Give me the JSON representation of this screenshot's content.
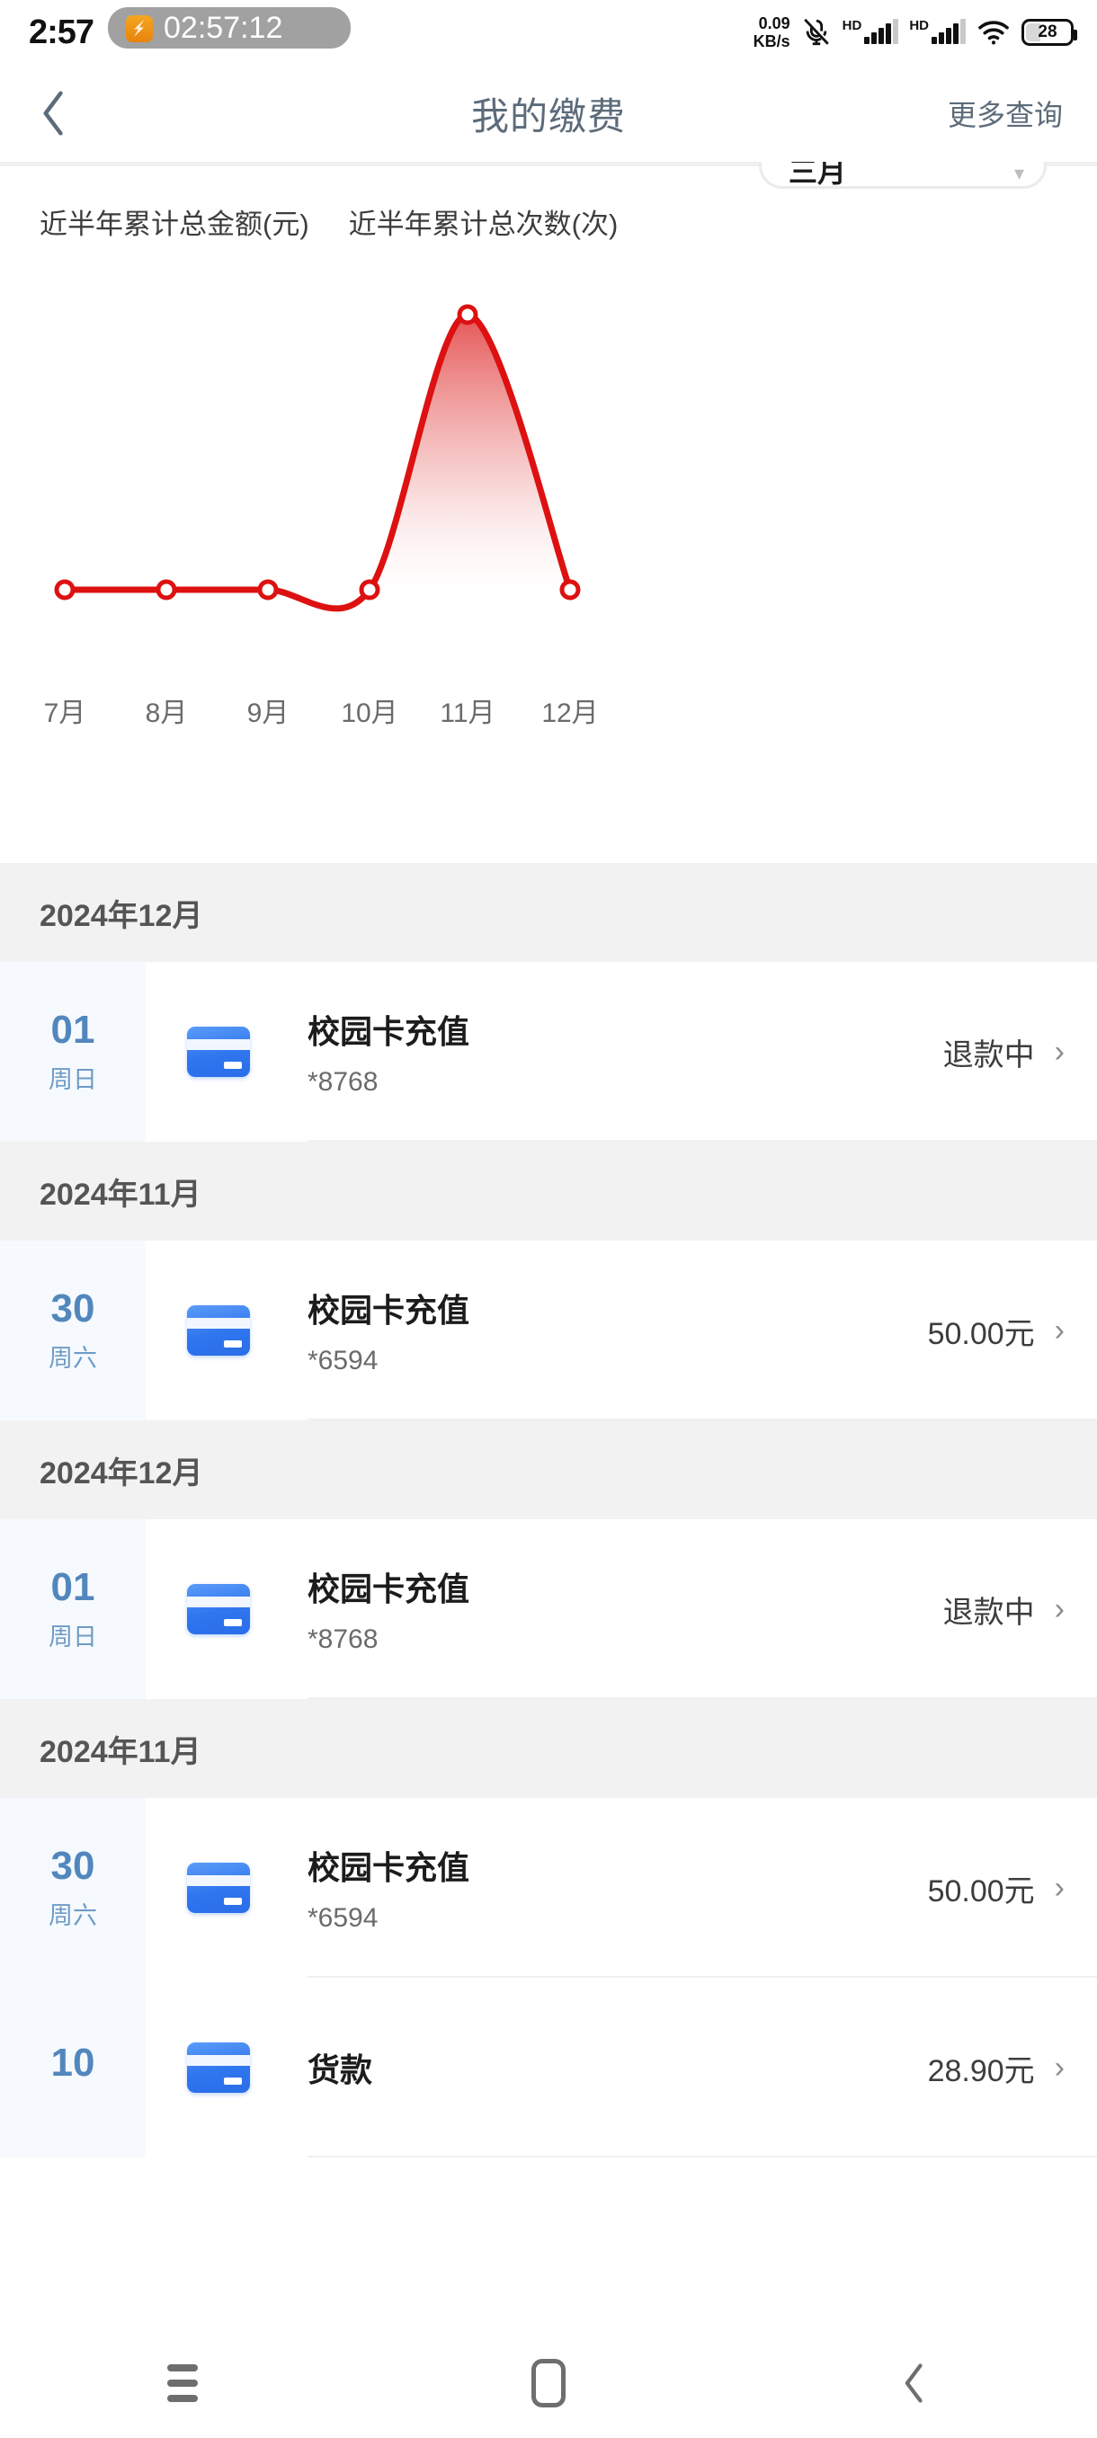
{
  "status_bar": {
    "clock": "2:57",
    "recording_timer": "02:57:12",
    "net_speed_value": "0.09",
    "net_speed_unit": "KB/s",
    "hd_label_1": "HD",
    "hd_label_2": "HD",
    "battery_level": "28",
    "icons": [
      "mute-icon",
      "signal-icon",
      "signal-icon",
      "wifi-icon",
      "battery-icon"
    ]
  },
  "nav_header": {
    "back_icon": "chevron-left-icon",
    "title": "我的缴费",
    "more_label": "更多查询"
  },
  "chart_panel": {
    "dropdown_value": "三月",
    "dropdown_caret": "chevron-down-icon",
    "legend": [
      "近半年累计总金额(元)",
      "近半年累计总次数(次)"
    ]
  },
  "chart_data": {
    "type": "line",
    "title": "",
    "xlabel": "",
    "ylabel": "",
    "categories": [
      "7月",
      "8月",
      "9月",
      "10月",
      "11月",
      "12月"
    ],
    "series": [
      {
        "name": "近半年累计总金额(元)",
        "values": [
          0,
          0,
          0,
          0,
          100,
          0
        ],
        "color": "#dd1111"
      }
    ],
    "ylim": [
      0,
      100
    ],
    "grid": false,
    "legend_position": "top-left",
    "area_fill": true,
    "marker": "open-circle"
  },
  "list": {
    "sections": [
      {
        "header": "2024年12月",
        "rows": [
          {
            "day": "01",
            "weekday": "周日",
            "icon": "bank-card-icon",
            "title": "校园卡充值",
            "subtitle": "*8768",
            "amount": "退款中",
            "chevron": "chevron-right-icon"
          }
        ]
      },
      {
        "header": "2024年11月",
        "rows": [
          {
            "day": "30",
            "weekday": "周六",
            "icon": "bank-card-icon",
            "title": "校园卡充值",
            "subtitle": "*6594",
            "amount": "50.00元",
            "chevron": "chevron-right-icon"
          }
        ]
      },
      {
        "header": "2024年12月",
        "rows": [
          {
            "day": "01",
            "weekday": "周日",
            "icon": "bank-card-icon",
            "title": "校园卡充值",
            "subtitle": "*8768",
            "amount": "退款中",
            "chevron": "chevron-right-icon"
          }
        ]
      },
      {
        "header": "2024年11月",
        "rows": [
          {
            "day": "30",
            "weekday": "周六",
            "icon": "bank-card-icon",
            "title": "校园卡充值",
            "subtitle": "*6594",
            "amount": "50.00元",
            "chevron": "chevron-right-icon"
          },
          {
            "day": "10",
            "weekday": "",
            "icon": "bank-card-icon",
            "title": "货款",
            "subtitle": "",
            "amount": "28.90元",
            "chevron": "chevron-right-icon"
          }
        ]
      }
    ]
  },
  "android_nav": {
    "recents": "recents-icon",
    "home": "home-icon",
    "back": "back-icon"
  }
}
